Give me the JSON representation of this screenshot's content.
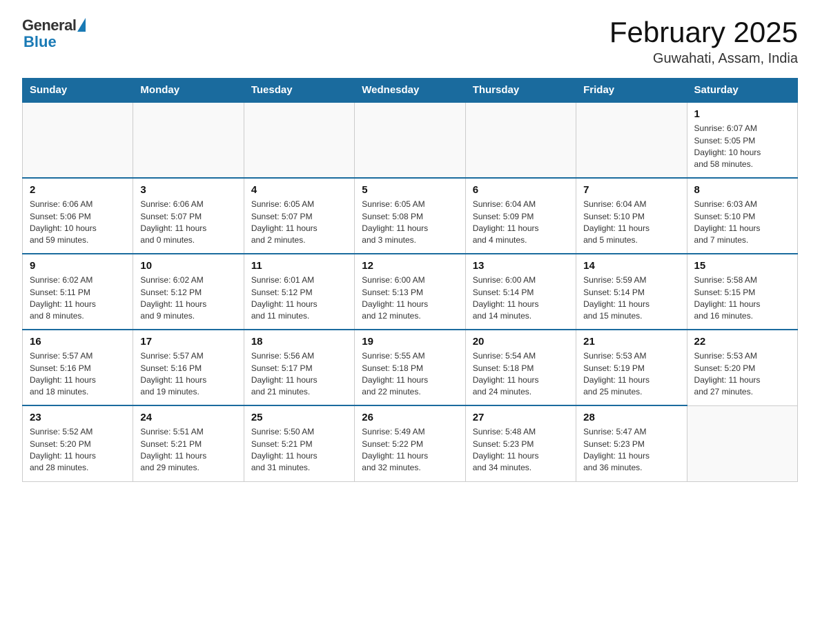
{
  "header": {
    "logo_general": "General",
    "logo_blue": "Blue",
    "month_title": "February 2025",
    "location": "Guwahati, Assam, India"
  },
  "weekdays": [
    "Sunday",
    "Monday",
    "Tuesday",
    "Wednesday",
    "Thursday",
    "Friday",
    "Saturday"
  ],
  "weeks": [
    [
      {
        "day": "",
        "info": ""
      },
      {
        "day": "",
        "info": ""
      },
      {
        "day": "",
        "info": ""
      },
      {
        "day": "",
        "info": ""
      },
      {
        "day": "",
        "info": ""
      },
      {
        "day": "",
        "info": ""
      },
      {
        "day": "1",
        "info": "Sunrise: 6:07 AM\nSunset: 5:05 PM\nDaylight: 10 hours\nand 58 minutes."
      }
    ],
    [
      {
        "day": "2",
        "info": "Sunrise: 6:06 AM\nSunset: 5:06 PM\nDaylight: 10 hours\nand 59 minutes."
      },
      {
        "day": "3",
        "info": "Sunrise: 6:06 AM\nSunset: 5:07 PM\nDaylight: 11 hours\nand 0 minutes."
      },
      {
        "day": "4",
        "info": "Sunrise: 6:05 AM\nSunset: 5:07 PM\nDaylight: 11 hours\nand 2 minutes."
      },
      {
        "day": "5",
        "info": "Sunrise: 6:05 AM\nSunset: 5:08 PM\nDaylight: 11 hours\nand 3 minutes."
      },
      {
        "day": "6",
        "info": "Sunrise: 6:04 AM\nSunset: 5:09 PM\nDaylight: 11 hours\nand 4 minutes."
      },
      {
        "day": "7",
        "info": "Sunrise: 6:04 AM\nSunset: 5:10 PM\nDaylight: 11 hours\nand 5 minutes."
      },
      {
        "day": "8",
        "info": "Sunrise: 6:03 AM\nSunset: 5:10 PM\nDaylight: 11 hours\nand 7 minutes."
      }
    ],
    [
      {
        "day": "9",
        "info": "Sunrise: 6:02 AM\nSunset: 5:11 PM\nDaylight: 11 hours\nand 8 minutes."
      },
      {
        "day": "10",
        "info": "Sunrise: 6:02 AM\nSunset: 5:12 PM\nDaylight: 11 hours\nand 9 minutes."
      },
      {
        "day": "11",
        "info": "Sunrise: 6:01 AM\nSunset: 5:12 PM\nDaylight: 11 hours\nand 11 minutes."
      },
      {
        "day": "12",
        "info": "Sunrise: 6:00 AM\nSunset: 5:13 PM\nDaylight: 11 hours\nand 12 minutes."
      },
      {
        "day": "13",
        "info": "Sunrise: 6:00 AM\nSunset: 5:14 PM\nDaylight: 11 hours\nand 14 minutes."
      },
      {
        "day": "14",
        "info": "Sunrise: 5:59 AM\nSunset: 5:14 PM\nDaylight: 11 hours\nand 15 minutes."
      },
      {
        "day": "15",
        "info": "Sunrise: 5:58 AM\nSunset: 5:15 PM\nDaylight: 11 hours\nand 16 minutes."
      }
    ],
    [
      {
        "day": "16",
        "info": "Sunrise: 5:57 AM\nSunset: 5:16 PM\nDaylight: 11 hours\nand 18 minutes."
      },
      {
        "day": "17",
        "info": "Sunrise: 5:57 AM\nSunset: 5:16 PM\nDaylight: 11 hours\nand 19 minutes."
      },
      {
        "day": "18",
        "info": "Sunrise: 5:56 AM\nSunset: 5:17 PM\nDaylight: 11 hours\nand 21 minutes."
      },
      {
        "day": "19",
        "info": "Sunrise: 5:55 AM\nSunset: 5:18 PM\nDaylight: 11 hours\nand 22 minutes."
      },
      {
        "day": "20",
        "info": "Sunrise: 5:54 AM\nSunset: 5:18 PM\nDaylight: 11 hours\nand 24 minutes."
      },
      {
        "day": "21",
        "info": "Sunrise: 5:53 AM\nSunset: 5:19 PM\nDaylight: 11 hours\nand 25 minutes."
      },
      {
        "day": "22",
        "info": "Sunrise: 5:53 AM\nSunset: 5:20 PM\nDaylight: 11 hours\nand 27 minutes."
      }
    ],
    [
      {
        "day": "23",
        "info": "Sunrise: 5:52 AM\nSunset: 5:20 PM\nDaylight: 11 hours\nand 28 minutes."
      },
      {
        "day": "24",
        "info": "Sunrise: 5:51 AM\nSunset: 5:21 PM\nDaylight: 11 hours\nand 29 minutes."
      },
      {
        "day": "25",
        "info": "Sunrise: 5:50 AM\nSunset: 5:21 PM\nDaylight: 11 hours\nand 31 minutes."
      },
      {
        "day": "26",
        "info": "Sunrise: 5:49 AM\nSunset: 5:22 PM\nDaylight: 11 hours\nand 32 minutes."
      },
      {
        "day": "27",
        "info": "Sunrise: 5:48 AM\nSunset: 5:23 PM\nDaylight: 11 hours\nand 34 minutes."
      },
      {
        "day": "28",
        "info": "Sunrise: 5:47 AM\nSunset: 5:23 PM\nDaylight: 11 hours\nand 36 minutes."
      },
      {
        "day": "",
        "info": ""
      }
    ]
  ]
}
